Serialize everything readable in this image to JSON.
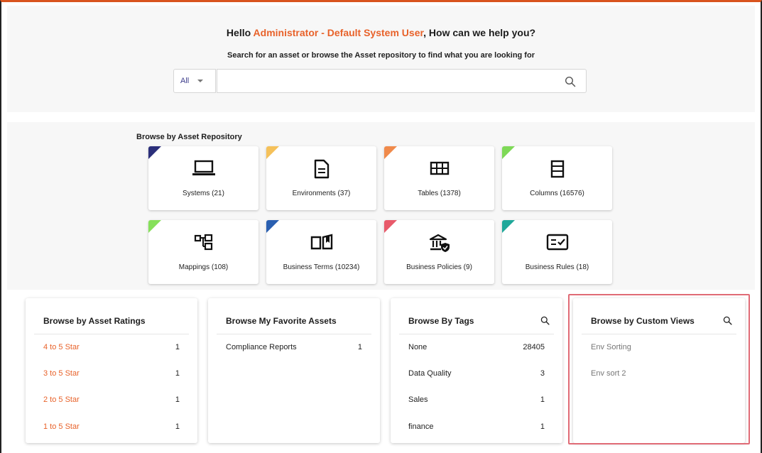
{
  "header": {
    "greeting_prefix": "Hello ",
    "user_name": "Administrator - Default System User",
    "greeting_suffix": ", How can we help you?",
    "subtitle": "Search for an asset or browse the Asset repository to find what you are looking for"
  },
  "search": {
    "filter_value": "All",
    "placeholder": "",
    "icon": "search-icon"
  },
  "repository": {
    "title": "Browse by Asset Repository",
    "tiles": [
      {
        "label": "Systems (21)",
        "icon": "laptop-icon",
        "color": "#2b2f7a"
      },
      {
        "label": "Environments (37)",
        "icon": "document-icon",
        "color": "#f5c15a"
      },
      {
        "label": "Tables (1378)",
        "icon": "table-icon",
        "color": "#f08a4b"
      },
      {
        "label": "Columns (16576)",
        "icon": "columns-icon",
        "color": "#7ed957"
      },
      {
        "label": "Mappings (108)",
        "icon": "mapping-icon",
        "color": "#86e05a"
      },
      {
        "label": "Business Terms (10234)",
        "icon": "book-icon",
        "color": "#2a5fb0"
      },
      {
        "label": "Business Policies (9)",
        "icon": "policy-icon",
        "color": "#e85a6a"
      },
      {
        "label": "Business Rules (18)",
        "icon": "rules-icon",
        "color": "#1fa89a"
      }
    ]
  },
  "ratings": {
    "title": "Browse by Asset Ratings",
    "rows": [
      {
        "label": "4 to 5 Star",
        "value": "1"
      },
      {
        "label": "3 to 5 Star",
        "value": "1"
      },
      {
        "label": "2 to 5 Star",
        "value": "1"
      },
      {
        "label": "1 to 5 Star",
        "value": "1"
      }
    ]
  },
  "favorites": {
    "title": "Browse My Favorite Assets",
    "rows": [
      {
        "label": "Compliance Reports",
        "value": "1"
      }
    ]
  },
  "tags": {
    "title": "Browse By Tags",
    "rows": [
      {
        "label": "None",
        "value": "28405"
      },
      {
        "label": "Data Quality",
        "value": "3"
      },
      {
        "label": "Sales",
        "value": "1"
      },
      {
        "label": "finance",
        "value": "1"
      }
    ]
  },
  "custom_views": {
    "title": "Browse by Custom Views",
    "rows": [
      {
        "label": "Env Sorting"
      },
      {
        "label": "Env sort 2"
      }
    ]
  },
  "colors": {
    "accent": "#e8622a",
    "highlight": "#e06b76"
  }
}
